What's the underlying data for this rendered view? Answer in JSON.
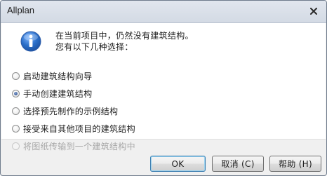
{
  "window": {
    "title": "Allplan",
    "close_symbol": "×"
  },
  "message": {
    "line1": "在当前项目中，仍然没有建筑结构。",
    "line2": "您有以下几种选择："
  },
  "options": [
    {
      "label": "启动建筑结构向导",
      "checked": false,
      "enabled": true
    },
    {
      "label": "手动创建建筑结构",
      "checked": true,
      "enabled": true
    },
    {
      "label": "选择预先制作的示例结构",
      "checked": false,
      "enabled": true
    },
    {
      "label": "接受来自其他项目的建筑结构",
      "checked": false,
      "enabled": true
    },
    {
      "label": "将图纸传输到一个建筑结构中",
      "checked": false,
      "enabled": false
    }
  ],
  "buttons": {
    "ok": "OK",
    "cancel": "取消 (C)",
    "help": "帮助 (H)"
  },
  "icons": {
    "info": "info-icon",
    "close": "close-icon"
  },
  "colors": {
    "info_icon": "#2b6fc9",
    "titlebar": "#d9dfe8",
    "disabled_text": "#a8a8a8"
  }
}
